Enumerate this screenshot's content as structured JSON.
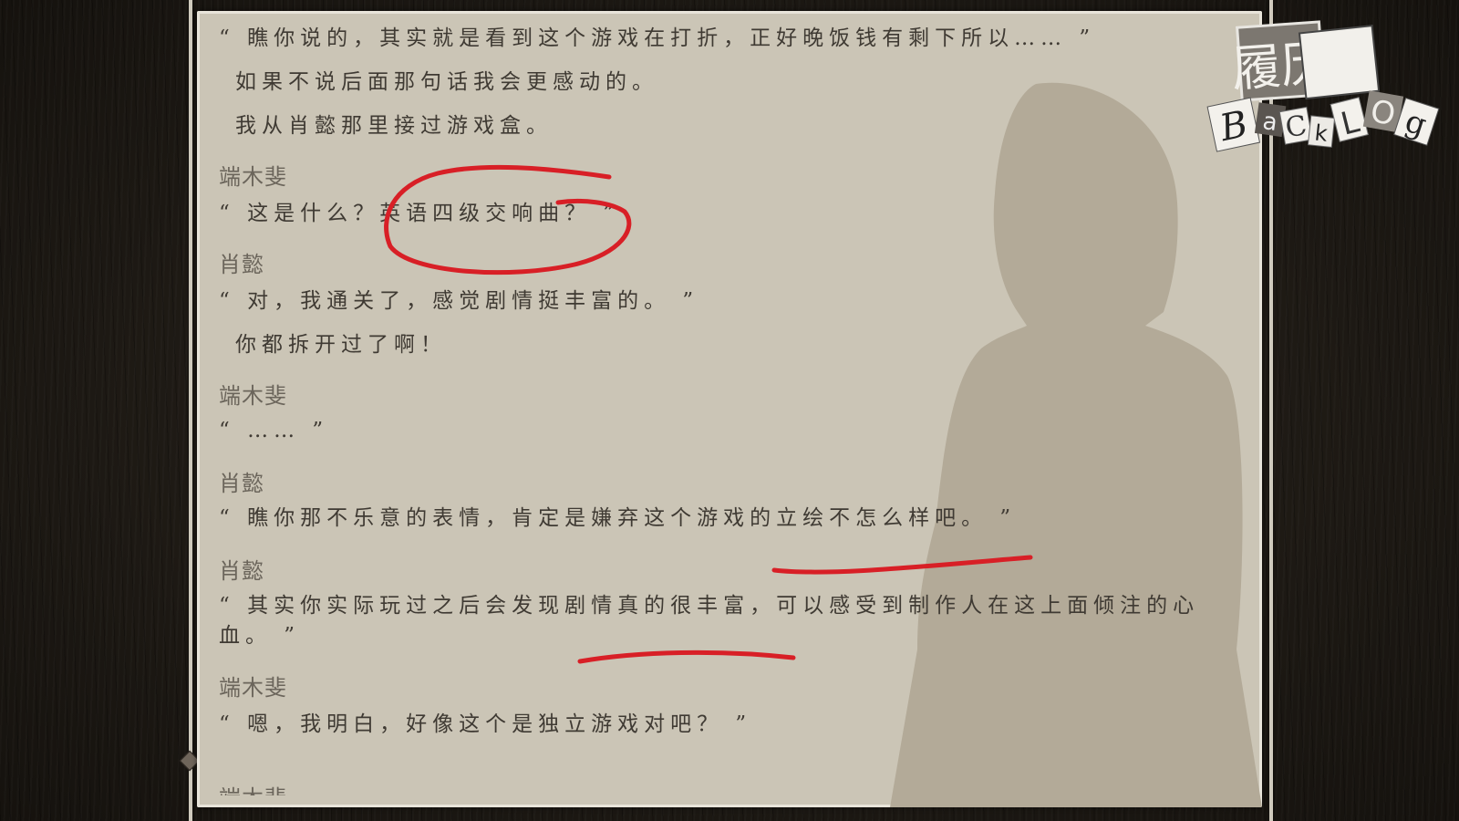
{
  "backlog": {
    "title_cn": "履历",
    "title_en_letters": [
      "B",
      "a",
      "C",
      "k",
      "L",
      "O",
      "g"
    ],
    "entries": [
      {
        "speaker": "",
        "text": "“ 瞧你说的，其实就是看到这个游戏在打折，正好晚饭钱有剩下所以…… ”"
      },
      {
        "speaker": "",
        "text": "如果不说后面那句话我会更感动的。"
      },
      {
        "speaker": "",
        "text": "我从肖懿那里接过游戏盒。"
      },
      {
        "speaker": "端木斐",
        "text": "“ 这是什么？英语四级交响曲？ ”"
      },
      {
        "speaker": "肖懿",
        "text": "“ 对，我通关了，感觉剧情挺丰富的。 ”"
      },
      {
        "speaker": "",
        "text": "你都拆开过了啊！"
      },
      {
        "speaker": "端木斐",
        "text": "“ …… ”"
      },
      {
        "speaker": "肖懿",
        "text": "“ 瞧你那不乐意的表情，肯定是嫌弃这个游戏的立绘不怎么样吧。 ”"
      },
      {
        "speaker": "肖懿",
        "text": "“ 其实你实际玩过之后会发现剧情真的很丰富，可以感受到制作人在这上面倾注的心血。 ”"
      },
      {
        "speaker": "端木斐",
        "text": "“ 嗯，我明白，好像这个是独立游戏对吧？ ”"
      },
      {
        "speaker": "端木斐",
        "text": ""
      }
    ]
  },
  "colors": {
    "panel": "#cbc5b6",
    "text": "#3f3a33",
    "speaker": "#6b655b",
    "annotation": "#d81f26",
    "silhouette": "#b3aa98"
  },
  "icons": {
    "logo": "backlog-logo",
    "scroll_handle": "diamond-knob-icon"
  }
}
